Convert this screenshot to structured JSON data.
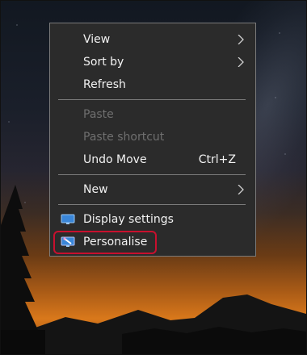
{
  "menu": {
    "view": "View",
    "sort_by": "Sort by",
    "refresh": "Refresh",
    "paste": "Paste",
    "paste_shortcut": "Paste shortcut",
    "undo_move": "Undo Move",
    "undo_move_shortcut": "Ctrl+Z",
    "new": "New",
    "display_settings": "Display settings",
    "personalise": "Personalise"
  },
  "icons": {
    "submenu": "chevron-right-icon",
    "display_settings": "monitor-icon",
    "personalise": "personalise-monitor-icon"
  },
  "colors": {
    "menu_background": "#2b2b2b",
    "menu_border": "#7a7a7a",
    "text": "#f2f2f2",
    "disabled_text": "#6f6f6f",
    "highlight": "#c8102e"
  }
}
